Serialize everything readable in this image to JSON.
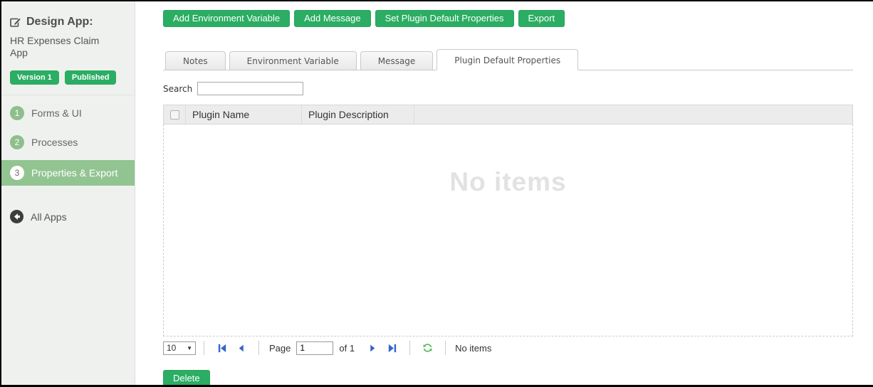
{
  "app": {
    "title": "Design App:",
    "name": "HR Expenses Claim App",
    "badges": {
      "version": "Version 1",
      "status": "Published"
    }
  },
  "sidebar": {
    "items": [
      {
        "number": "1",
        "label": "Forms & UI"
      },
      {
        "number": "2",
        "label": "Processes"
      },
      {
        "number": "3",
        "label": "Properties & Export"
      }
    ],
    "all_apps_label": "All Apps"
  },
  "toolbar": {
    "buttons": [
      "Add Environment Variable",
      "Add Message",
      "Set Plugin Default Properties",
      "Export"
    ]
  },
  "tabs": [
    {
      "label": "Notes"
    },
    {
      "label": "Environment Variable"
    },
    {
      "label": "Message"
    },
    {
      "label": "Plugin Default Properties"
    }
  ],
  "search": {
    "label": "Search",
    "value": ""
  },
  "table": {
    "columns": [
      "Plugin Name",
      "Plugin Description"
    ],
    "rows": [],
    "empty_text": "No items"
  },
  "pagination": {
    "page_size": "10",
    "page_label": "Page",
    "page_value": "1",
    "of_label": "of 1",
    "status": "No items"
  },
  "footer": {
    "delete_label": "Delete"
  },
  "colors": {
    "accent_green": "#2bad64",
    "sidebar_selected_green": "#92c492",
    "pager_blue": "#3366cc",
    "refresh_green": "#5cb85c",
    "watermark_gray": "#e2e2e2"
  }
}
